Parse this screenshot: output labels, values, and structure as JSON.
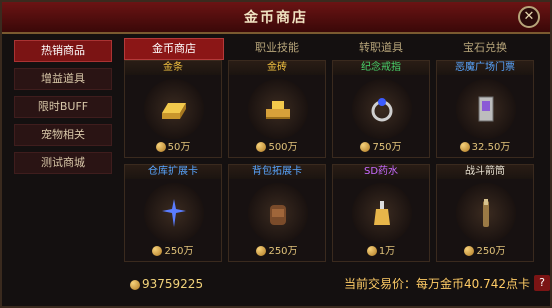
{
  "window": {
    "title": "金币商店",
    "close_label": "✕"
  },
  "sidebar": {
    "items": [
      {
        "label": "热销商品",
        "active": true
      },
      {
        "label": "增益道具",
        "active": false
      },
      {
        "label": "限时BUFF",
        "active": false
      },
      {
        "label": "宠物相关",
        "active": false
      },
      {
        "label": "测试商城",
        "active": false
      }
    ]
  },
  "tabs": [
    {
      "label": "金币商店",
      "active": true
    },
    {
      "label": "职业技能",
      "active": false
    },
    {
      "label": "转职道具",
      "active": false
    },
    {
      "label": "宝石兑换",
      "active": false
    }
  ],
  "items": [
    {
      "name": "金条",
      "name_color": "#f0c040",
      "price": "50万",
      "icon": "gold-bar-icon"
    },
    {
      "name": "金砖",
      "name_color": "#f0c040",
      "price": "500万",
      "icon": "gold-bricks-icon"
    },
    {
      "name": "纪念戒指",
      "name_color": "#49d36b",
      "price": "750万",
      "icon": "ring-icon"
    },
    {
      "name": "恶魔广场门票",
      "name_color": "#59a6ff",
      "price": "32.50万",
      "icon": "ticket-icon"
    },
    {
      "name": "仓库扩展卡",
      "name_color": "#59a6ff",
      "price": "250万",
      "icon": "warehouse-card-icon"
    },
    {
      "name": "背包拓展卡",
      "name_color": "#59a6ff",
      "price": "250万",
      "icon": "backpack-icon"
    },
    {
      "name": "SD药水",
      "name_color": "#c86bff",
      "price": "1万",
      "icon": "potion-icon"
    },
    {
      "name": "战斗箭筒",
      "name_color": "#e9e2d2",
      "price": "250万",
      "icon": "quiver-icon"
    }
  ],
  "footer": {
    "balance": "93759225",
    "rate_text": "当前交易价：每万金币40.742点卡",
    "help_label": "?"
  },
  "colors": {
    "accent": "#8b1616",
    "gold": "#f2d37a"
  }
}
